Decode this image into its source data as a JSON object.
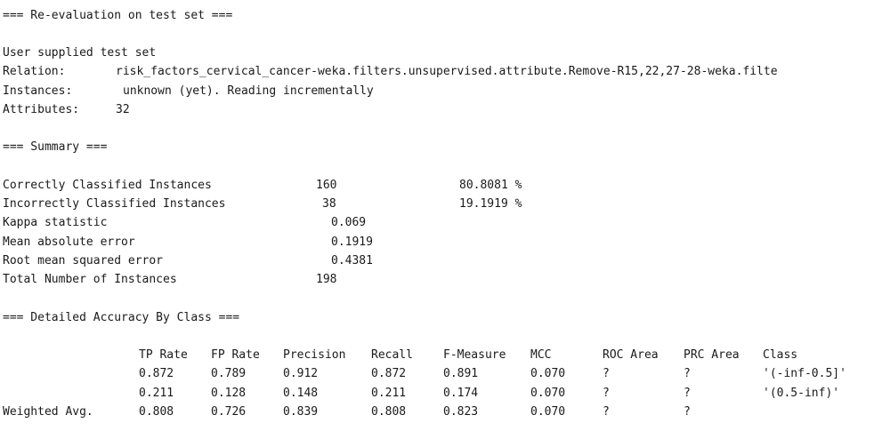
{
  "header": "=== Re-evaluation on test set ===",
  "test_set": {
    "source": "User supplied test set",
    "relation_label": "Relation:",
    "relation_value": "risk_factors_cervical_cancer-weka.filters.unsupervised.attribute.Remove-R15,22,27-28-weka.filte",
    "instances_label": "Instances:",
    "instances_value": "unknown (yet). Reading incrementally",
    "attributes_label": "Attributes:",
    "attributes_value": "32"
  },
  "summary": {
    "header": "=== Summary ===",
    "rows": [
      {
        "label": "Correctly Classified Instances",
        "value": "160",
        "pct": "80.8081 %"
      },
      {
        "label": "Incorrectly Classified Instances",
        "value": "38",
        "pct": "19.1919 %"
      },
      {
        "label": "Kappa statistic",
        "value": "0.069",
        "pct": ""
      },
      {
        "label": "Mean absolute error",
        "value": "0.1919",
        "pct": ""
      },
      {
        "label": "Root mean squared error",
        "value": "0.4381",
        "pct": ""
      },
      {
        "label": "Total Number of Instances",
        "value": "198",
        "pct": ""
      }
    ]
  },
  "accuracy": {
    "header": "=== Detailed Accuracy By Class ===",
    "columns": [
      "TP Rate",
      "FP Rate",
      "Precision",
      "Recall",
      "F-Measure",
      "MCC",
      "ROC Area",
      "PRC Area",
      "Class"
    ],
    "rows": [
      {
        "label": "",
        "cells": [
          "0.872",
          "0.789",
          "0.912",
          "0.872",
          "0.891",
          "0.070",
          "?",
          "?",
          "'(-inf-0.5]'"
        ]
      },
      {
        "label": "",
        "cells": [
          "0.211",
          "0.128",
          "0.148",
          "0.211",
          "0.174",
          "0.070",
          "?",
          "?",
          "'(0.5-inf)'"
        ]
      },
      {
        "label": "Weighted Avg.",
        "cells": [
          "0.808",
          "0.726",
          "0.839",
          "0.808",
          "0.823",
          "0.070",
          "?",
          "?",
          ""
        ]
      }
    ]
  }
}
